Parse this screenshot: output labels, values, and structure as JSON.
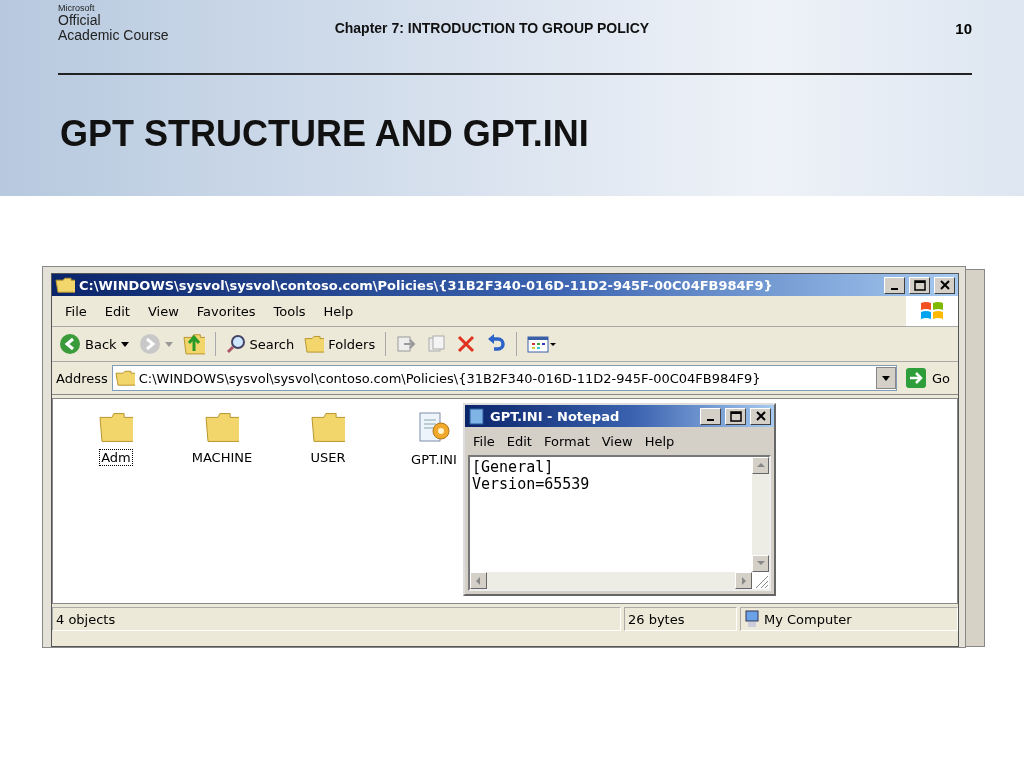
{
  "header": {
    "brand": {
      "company": "Microsoft",
      "line1": "Official",
      "line2": "Academic Course"
    },
    "chapter": "Chapter 7: INTRODUCTION TO GROUP POLICY",
    "page_number": "10"
  },
  "title": "GPT STRUCTURE AND GPT.INI",
  "explorer": {
    "title": "C:\\WINDOWS\\sysvol\\sysvol\\contoso.com\\Policies\\{31B2F340-016D-11D2-945F-00C04FB984F9}",
    "menu": [
      "File",
      "Edit",
      "View",
      "Favorites",
      "Tools",
      "Help"
    ],
    "toolbar": [
      {
        "kind": "back",
        "label": "Back"
      },
      {
        "kind": "forward"
      },
      {
        "kind": "up"
      },
      {
        "kind": "search",
        "label": "Search"
      },
      {
        "kind": "folders",
        "label": "Folders"
      },
      {
        "kind": "move"
      },
      {
        "kind": "copy"
      },
      {
        "kind": "delete"
      },
      {
        "kind": "undo"
      },
      {
        "kind": "views"
      }
    ],
    "address": {
      "label": "Address",
      "value": "C:\\WINDOWS\\sysvol\\sysvol\\contoso.com\\Policies\\{31B2F340-016D-11D2-945F-00C04FB984F9}",
      "go": "Go"
    },
    "items": [
      {
        "kind": "folder",
        "name": "Adm",
        "selected": true
      },
      {
        "kind": "folder",
        "name": "MACHINE",
        "selected": false
      },
      {
        "kind": "folder",
        "name": "USER",
        "selected": false
      },
      {
        "kind": "file",
        "name": "GPT.INI",
        "selected": false
      }
    ],
    "status": [
      "4 objects",
      "26 bytes",
      "My Computer"
    ]
  },
  "notepad": {
    "title": "GPT.INI - Notepad",
    "menu": [
      "File",
      "Edit",
      "Format",
      "View",
      "Help"
    ],
    "lines": [
      "[General]",
      "Version=65539"
    ]
  }
}
